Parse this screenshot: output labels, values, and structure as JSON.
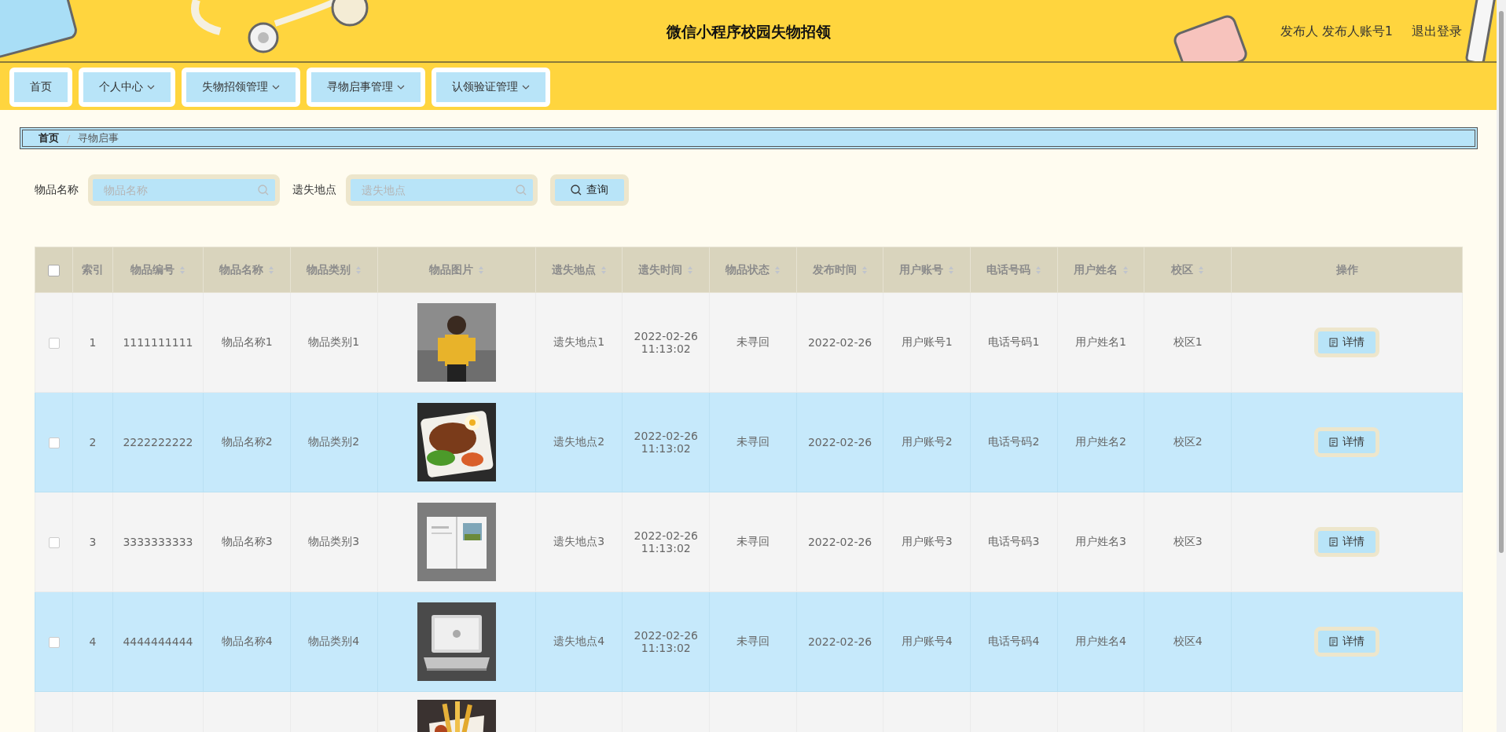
{
  "header": {
    "title": "微信小程序校园失物招领",
    "user": "发布人 发布人账号1",
    "logout": "退出登录"
  },
  "nav": [
    {
      "label": "首页",
      "dropdown": false
    },
    {
      "label": "个人中心",
      "dropdown": true
    },
    {
      "label": "失物招领管理",
      "dropdown": true
    },
    {
      "label": "寻物启事管理",
      "dropdown": true
    },
    {
      "label": "认领验证管理",
      "dropdown": true
    }
  ],
  "breadcrumb": {
    "items": [
      "首页",
      "寻物启事"
    ],
    "separator": "/"
  },
  "search": {
    "fields": [
      {
        "label": "物品名称",
        "placeholder": "物品名称"
      },
      {
        "label": "遗失地点",
        "placeholder": "遗失地点"
      }
    ],
    "button": "查询"
  },
  "table": {
    "select_all": {
      "checked": false
    },
    "columns": [
      {
        "label": "索引",
        "sortable": false
      },
      {
        "label": "物品编号",
        "sortable": true
      },
      {
        "label": "物品名称",
        "sortable": true
      },
      {
        "label": "物品类别",
        "sortable": true
      },
      {
        "label": "物品图片",
        "sortable": true
      },
      {
        "label": "遗失地点",
        "sortable": true
      },
      {
        "label": "遗失时间",
        "sortable": true
      },
      {
        "label": "物品状态",
        "sortable": true
      },
      {
        "label": "发布时间",
        "sortable": true
      },
      {
        "label": "用户账号",
        "sortable": true
      },
      {
        "label": "电话号码",
        "sortable": true
      },
      {
        "label": "用户姓名",
        "sortable": true
      },
      {
        "label": "校区",
        "sortable": true
      },
      {
        "label": "操作",
        "sortable": false
      }
    ],
    "rows": [
      {
        "checked": false,
        "cells": [
          "1",
          "1111111111",
          "物品名称1",
          "物品类别1",
          {
            "kind": "picture"
          },
          "遗失地点1",
          "2022-02-26 11:13:02",
          "未寻回",
          "2022-02-26",
          "用户账号1",
          "电话号码1",
          "用户姓名1",
          "校区1"
        ],
        "action": "详情"
      },
      {
        "checked": false,
        "cells": [
          "2",
          "2222222222",
          "物品名称2",
          "物品类别2",
          {
            "kind": "picture"
          },
          "遗失地点2",
          "2022-02-26 11:13:02",
          "未寻回",
          "2022-02-26",
          "用户账号2",
          "电话号码2",
          "用户姓名2",
          "校区2"
        ],
        "action": "详情"
      },
      {
        "checked": false,
        "cells": [
          "3",
          "3333333333",
          "物品名称3",
          "物品类别3",
          {
            "kind": "picture"
          },
          "遗失地点3",
          "2022-02-26 11:13:02",
          "未寻回",
          "2022-02-26",
          "用户账号3",
          "电话号码3",
          "用户姓名3",
          "校区3"
        ],
        "action": "详情"
      },
      {
        "checked": false,
        "cells": [
          "4",
          "4444444444",
          "物品名称4",
          "物品类别4",
          {
            "kind": "picture"
          },
          "遗失地点4",
          "2022-02-26 11:13:02",
          "未寻回",
          "2022-02-26",
          "用户账号4",
          "电话号码4",
          "用户姓名4",
          "校区4"
        ],
        "action": "详情"
      },
      {
        "cells": [
          null,
          null,
          null,
          null,
          {
            "kind": "picture"
          }
        ]
      }
    ]
  }
}
